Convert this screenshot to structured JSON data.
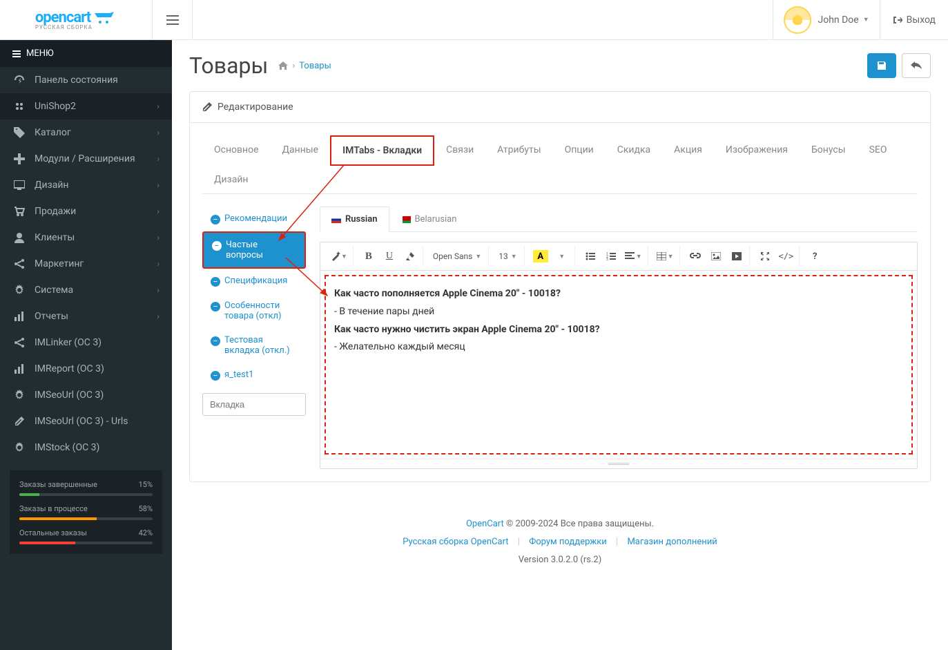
{
  "header": {
    "logo_main": "opencart",
    "logo_sub": "РУССКАЯ СБОРКА",
    "user_name": "John Doe",
    "logout": "Выход"
  },
  "sidebar": {
    "menu_label": "МЕНЮ",
    "items": [
      {
        "label": "Панель состояния",
        "expandable": false
      },
      {
        "label": "UniShop2",
        "expandable": true,
        "active": true
      },
      {
        "label": "Каталог",
        "expandable": true
      },
      {
        "label": "Модули / Расширения",
        "expandable": true
      },
      {
        "label": "Дизайн",
        "expandable": true
      },
      {
        "label": "Продажи",
        "expandable": true
      },
      {
        "label": "Клиенты",
        "expandable": true
      },
      {
        "label": "Маркетинг",
        "expandable": true
      },
      {
        "label": "Система",
        "expandable": true
      },
      {
        "label": "Отчеты",
        "expandable": true
      },
      {
        "label": "IMLinker (OC 3)",
        "expandable": false
      },
      {
        "label": "IMReport (OC 3)",
        "expandable": false
      },
      {
        "label": "IMSeoUrl (OC 3)",
        "expandable": false
      },
      {
        "label": "IMSeoUrl (OC 3) - Urls",
        "expandable": false
      },
      {
        "label": "IMStock (OC 3)",
        "expandable": false
      }
    ],
    "stats": [
      {
        "label": "Заказы завершенные",
        "value": "15%",
        "pct": 15,
        "color": "#4caf50"
      },
      {
        "label": "Заказы в процессе",
        "value": "58%",
        "pct": 58,
        "color": "#ff9800"
      },
      {
        "label": "Остальные заказы",
        "value": "42%",
        "pct": 42,
        "color": "#f44336"
      }
    ]
  },
  "page": {
    "title": "Товары",
    "breadcrumb_link": "Товары",
    "panel_title": "Редактирование"
  },
  "htabs": [
    "Основное",
    "Данные",
    "IMTabs - Вкладки",
    "Связи",
    "Атрибуты",
    "Опции",
    "Скидка",
    "Акция",
    "Изображения",
    "Бонусы",
    "SEO",
    "Дизайн"
  ],
  "htab_active": 2,
  "vtabs": [
    "Рекомендации",
    "Частые вопросы",
    "Спецификация",
    "Особенности товара (откл)",
    "Тестовая вкладка (откл.)",
    "я_test1"
  ],
  "vtab_active": 1,
  "vtab_placeholder": "Вкладка",
  "lang_tabs": [
    {
      "label": "Russian",
      "flag": "ru",
      "active": true
    },
    {
      "label": "Belarusian",
      "flag": "be",
      "active": false
    }
  ],
  "toolbar": {
    "font": "Open Sans",
    "size": "13"
  },
  "editor_content": {
    "q1": "Как часто пополняется Apple Cinema 20\" - 10018?",
    "a1": "- В течение пары дней",
    "q2": "Как часто нужно чистить экран Apple Cinema 20\" - 10018?",
    "a2": "- Желательно каждый месяц"
  },
  "footer": {
    "link1": "OpenCart",
    "copyright": " © 2009-2024 Все права защищены.",
    "link2": "Русская сборка OpenCart",
    "link3": "Форум поддержки",
    "link4": "Магазин дополнений",
    "version": "Version 3.0.2.0 (rs.2)"
  }
}
